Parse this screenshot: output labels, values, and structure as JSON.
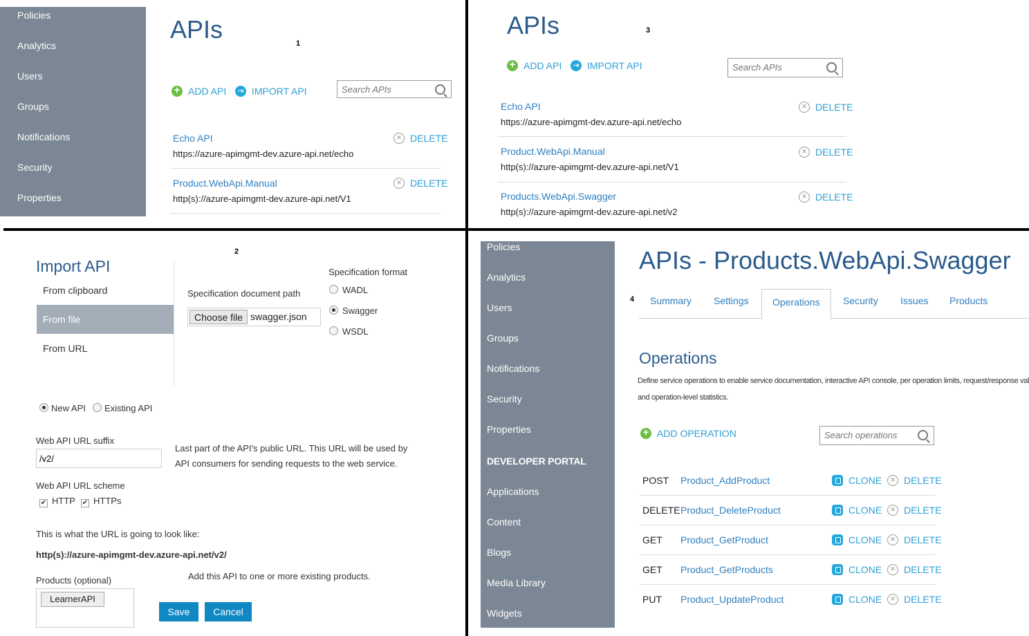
{
  "panel1": {
    "nav": [
      "Policies",
      "Analytics",
      "Users",
      "Groups",
      "Notifications",
      "Security",
      "Properties"
    ],
    "title": "APIs",
    "marker": "1",
    "add_label": "ADD API",
    "import_label": "IMPORT API",
    "search_placeholder": "Search APIs",
    "apis": [
      {
        "name": "Echo API",
        "url": "https://azure-apimgmt-dev.azure-api.net/echo",
        "delete": "DELETE"
      },
      {
        "name": "Product.WebApi.Manual",
        "url": "http(s)://azure-apimgmt-dev.azure-api.net/V1",
        "delete": "DELETE"
      }
    ]
  },
  "panel3": {
    "title": "APIs",
    "marker": "3",
    "add_label": "ADD API",
    "import_label": "IMPORT API",
    "search_placeholder": "Search APIs",
    "apis": [
      {
        "name": "Echo API",
        "url": "https://azure-apimgmt-dev.azure-api.net/echo",
        "delete": "DELETE"
      },
      {
        "name": "Product.WebApi.Manual",
        "url": "http(s)://azure-apimgmt-dev.azure-api.net/V1",
        "delete": "DELETE"
      },
      {
        "name": "Products.WebApi.Swagger",
        "url": "http(s)://azure-apimgmt-dev.azure-api.net/v2",
        "delete": "DELETE"
      }
    ]
  },
  "panel2": {
    "marker": "2",
    "title": "Import API",
    "sources": [
      "From clipboard",
      "From file",
      "From URL"
    ],
    "selected_source": "From file",
    "spec_path_label": "Specification document path",
    "choose_file": "Choose file",
    "file_name": "swagger.json",
    "spec_format_label": "Specification format",
    "formats": [
      "WADL",
      "Swagger",
      "WSDL"
    ],
    "selected_format": "Swagger",
    "new_api": "New API",
    "existing_api": "Existing API",
    "suffix_label": "Web API URL suffix",
    "suffix_value": "/v2/",
    "suffix_help_1": "Last part of the API's public URL. This URL will be used by",
    "suffix_help_2": "API consumers for sending requests to the web service.",
    "scheme_label": "Web API URL scheme",
    "scheme_http": "HTTP",
    "scheme_https": "HTTPs",
    "preview_label": "This is what the URL is going to look like:",
    "preview_url": "http(s)://azure-apimgmt-dev.azure-api.net/v2/",
    "products_label": "Products (optional)",
    "products_help": "Add this API to one or more existing products.",
    "product_tag": "LearnerAPI",
    "save": "Save",
    "cancel": "Cancel"
  },
  "panel4": {
    "marker": "4",
    "nav": [
      "Policies",
      "Analytics",
      "Users",
      "Groups",
      "Notifications",
      "Security",
      "Properties",
      "DEVELOPER PORTAL",
      "Applications",
      "Content",
      "Blogs",
      "Media Library",
      "Widgets"
    ],
    "title": "APIs - Products.WebApi.Swagger",
    "tabs": [
      "Summary",
      "Settings",
      "Operations",
      "Security",
      "Issues",
      "Products"
    ],
    "active_tab": "Operations",
    "section_title": "Operations",
    "description_1": "Define service operations to enable service documentation, interactive API console, per operation limits, request/response validation",
    "description_2": "and operation-level statistics.",
    "add_label": "ADD OPERATION",
    "search_placeholder": "Search operations",
    "clone_label": "CLONE",
    "delete_label": "DELETE",
    "operations": [
      {
        "method": "POST",
        "name": "Product_AddProduct"
      },
      {
        "method": "DELETE",
        "name": "Product_DeleteProduct"
      },
      {
        "method": "GET",
        "name": "Product_GetProduct"
      },
      {
        "method": "GET",
        "name": "Product_GetProducts"
      },
      {
        "method": "PUT",
        "name": "Product_UpdateProduct"
      }
    ]
  }
}
